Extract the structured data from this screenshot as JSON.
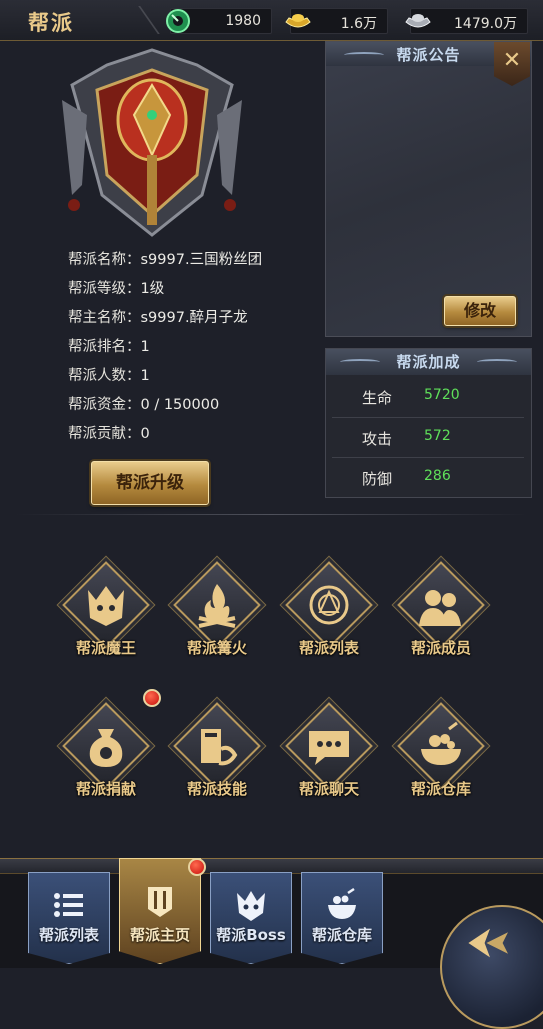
{
  "header": {
    "title": "帮派",
    "resources": [
      {
        "icon": "jade-icon",
        "value": "1980"
      },
      {
        "icon": "gold-ingot-icon",
        "value": "1.6万"
      },
      {
        "icon": "silver-ingot-icon",
        "value": "1479.0万"
      }
    ]
  },
  "guild": {
    "name_label": "帮派名称：",
    "name": "s9997.三国粉丝团",
    "level_label": "帮派等级：",
    "level": "1级",
    "leader_label": "帮主名称：",
    "leader": "s9997.醉月子龙",
    "rank_label": "帮派排名：",
    "rank": "1",
    "members_label": "帮派人数：",
    "members": "1",
    "funds_label": "帮派资金：",
    "funds": "0 / 150000",
    "contribution_label": "帮派贡献：",
    "contribution": "0",
    "upgrade_label": "帮派升级"
  },
  "notice": {
    "title": "帮派公告",
    "content": "",
    "edit_label": "修改"
  },
  "bonus": {
    "title": "帮派加成",
    "stats": [
      {
        "label": "生命",
        "value": "5720"
      },
      {
        "label": "攻击",
        "value": "572"
      },
      {
        "label": "防御",
        "value": "286"
      }
    ]
  },
  "functions": [
    {
      "label": "帮派魔王",
      "icon": "demon-king-icon",
      "badge": false
    },
    {
      "label": "帮派篝火",
      "icon": "bonfire-icon",
      "badge": false
    },
    {
      "label": "帮派列表",
      "icon": "emblem-list-icon",
      "badge": false
    },
    {
      "label": "帮派成员",
      "icon": "members-icon",
      "badge": false
    },
    {
      "label": "帮派捐献",
      "icon": "donation-bag-icon",
      "badge": true
    },
    {
      "label": "帮派技能",
      "icon": "skill-book-icon",
      "badge": false
    },
    {
      "label": "帮派聊天",
      "icon": "chat-bubble-icon",
      "badge": false
    },
    {
      "label": "帮派仓库",
      "icon": "treasure-bowl-icon",
      "badge": false
    }
  ],
  "tabs": [
    {
      "label": "帮派列表",
      "icon": "list-icon",
      "active": false
    },
    {
      "label": "帮派主页",
      "icon": "banner-icon",
      "active": true
    },
    {
      "label": "帮派Boss",
      "icon": "boss-icon",
      "active": false
    },
    {
      "label": "帮派仓库",
      "icon": "storehouse-icon",
      "active": false
    }
  ],
  "colors": {
    "gold": "#e9c98a",
    "stat_value": "#5fe05a",
    "badge": "#d0160f",
    "tab_blue": "#3b5078"
  }
}
